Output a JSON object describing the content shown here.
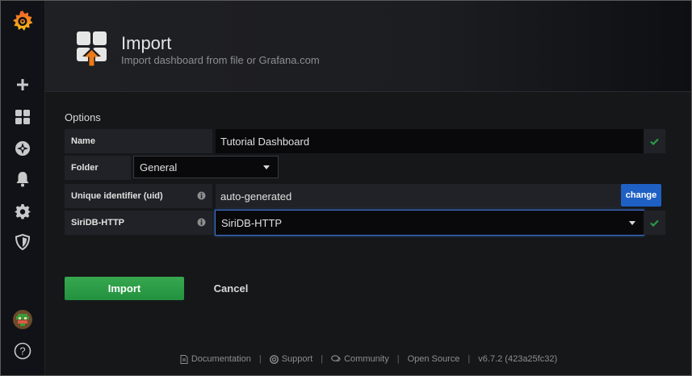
{
  "colors": {
    "accent": "#eb7b18",
    "primary_button": "#299c46",
    "change_button": "#1f60c4",
    "check": "#299c46"
  },
  "sidebar": {
    "items": [
      {
        "icon": "grafana-logo-icon"
      },
      {
        "icon": "plus-icon"
      },
      {
        "icon": "dashboards-icon"
      },
      {
        "icon": "explore-compass-icon"
      },
      {
        "icon": "bell-alerting-icon"
      },
      {
        "icon": "gear-icon"
      },
      {
        "icon": "shield-icon"
      },
      {
        "icon": "avatar"
      },
      {
        "icon": "help-icon"
      }
    ],
    "help_label": "?"
  },
  "header": {
    "title": "Import",
    "subtitle": "Import dashboard from file or Grafana.com"
  },
  "options": {
    "title": "Options",
    "name_label": "Name",
    "name_value": "Tutorial Dashboard",
    "folder_label": "Folder",
    "folder_value": "General",
    "uid_label": "Unique identifier (uid)",
    "uid_value": "auto-generated",
    "uid_change": "change",
    "datasource_label": "SiriDB-HTTP",
    "datasource_value": "SiriDB-HTTP"
  },
  "actions": {
    "import": "Import",
    "cancel": "Cancel"
  },
  "footer": {
    "documentation": "Documentation",
    "support": "Support",
    "community": "Community",
    "open_source": "Open Source",
    "version": "v6.7.2 (423a25fc32)",
    "separator": "|"
  }
}
